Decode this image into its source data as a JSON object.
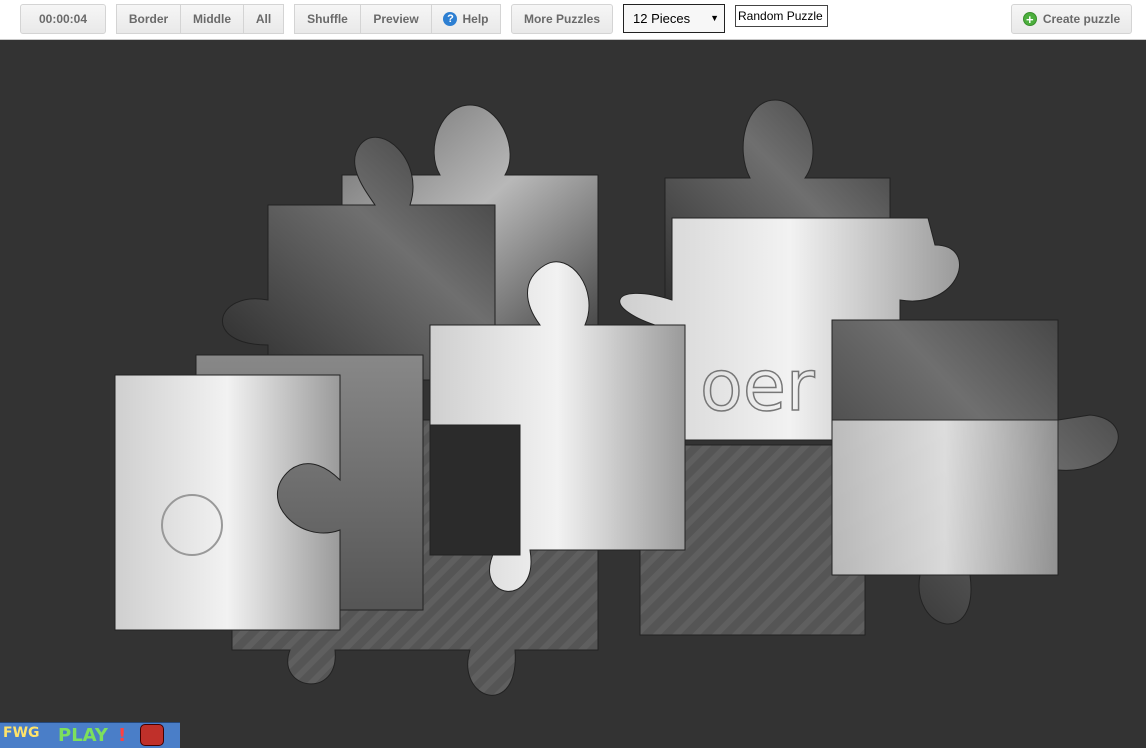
{
  "toolbar": {
    "timer": "00:00:04",
    "filter_buttons": [
      "Border",
      "Middle",
      "All"
    ],
    "shuffle": "Shuffle",
    "preview": "Preview",
    "help": "Help",
    "help_icon": "question-circle-icon",
    "more_puzzles": "More Puzzles",
    "pieces_select": {
      "selected": "12 Pieces"
    },
    "random_puzzle_value": "Random Puzzle",
    "create_puzzle": "Create puzzle",
    "create_icon": "plus-circle-icon"
  },
  "footer_logo": {
    "fwg": "FWG",
    "play": "PLAY",
    "bang": "!"
  },
  "colors": {
    "board_background": "#333333",
    "toolbar_background": "#ffffff",
    "help_blue": "#2d7fd2",
    "create_green": "#4caf3d"
  }
}
